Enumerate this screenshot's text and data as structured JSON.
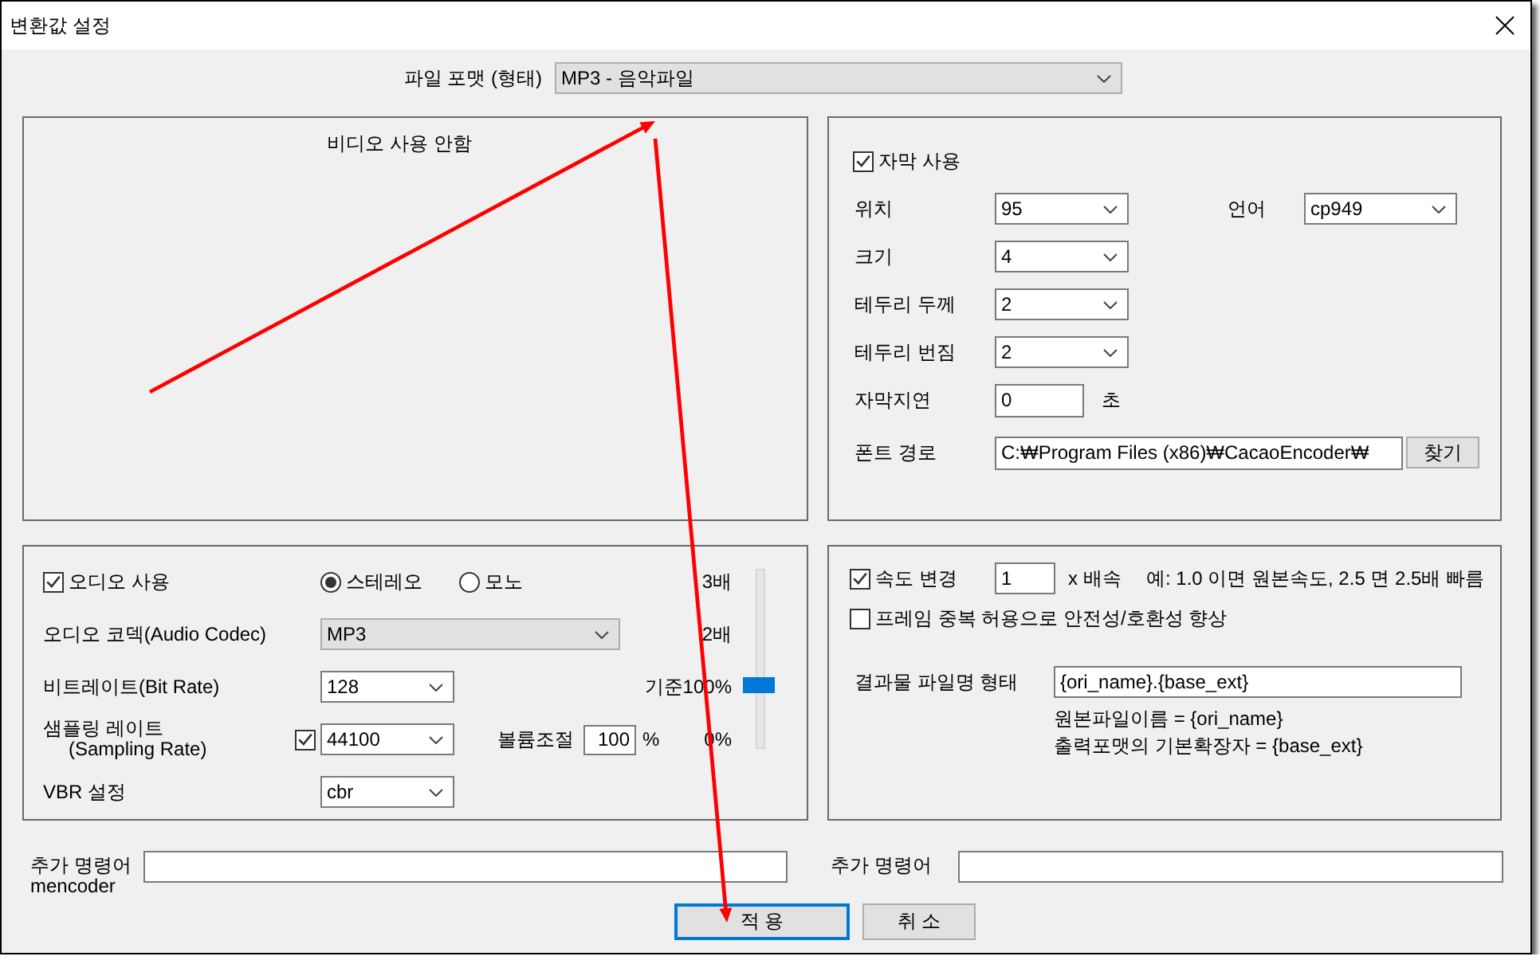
{
  "window": {
    "title": "변환값 설정"
  },
  "file_format": {
    "label": "파일 포맷 (형태)",
    "value": "MP3 - 음악파일"
  },
  "video_panel": {
    "message": "비디오 사용 안함"
  },
  "subtitle_panel": {
    "enable": {
      "label": "자막 사용",
      "checked": true
    },
    "language": {
      "label": "언어",
      "value": "cp949"
    },
    "fields": [
      {
        "kind": "select",
        "label": "위치",
        "value": "95"
      },
      {
        "kind": "select",
        "label": "크기",
        "value": "4"
      },
      {
        "kind": "select",
        "label": "테두리 두께",
        "value": "2"
      },
      {
        "kind": "select",
        "label": "테두리 번짐",
        "value": "2"
      },
      {
        "kind": "input",
        "label": "자막지연",
        "value": "0",
        "unit": "초"
      },
      {
        "kind": "path",
        "label": "폰트 경로",
        "value": "C:₩Program Files (x86)₩CacaoEncoder₩",
        "button": "찾기"
      }
    ]
  },
  "audio_panel": {
    "enable": {
      "label": "오디오 사용",
      "checked": true
    },
    "channels": [
      {
        "label": "스테레오",
        "selected": true
      },
      {
        "label": "모노",
        "selected": false
      }
    ],
    "codec": {
      "label": "오디오 코덱(Audio Codec)",
      "value": "MP3"
    },
    "bitrate": {
      "label": "비트레이트(Bit Rate)",
      "value": "128"
    },
    "sampling": {
      "label": [
        "샘플링 레이트",
        "(Sampling Rate)"
      ],
      "checked": true,
      "value": "44100"
    },
    "volume": {
      "label": "볼륨조절",
      "value": "100",
      "unit": "%"
    },
    "vbr": {
      "label": "VBR 설정",
      "value": "cbr"
    },
    "volume_slider": {
      "ticks": [
        "3배",
        "2배",
        "기준100%",
        "0%"
      ],
      "level": 0.35
    }
  },
  "speed_panel": {
    "speed": {
      "label": "속도 변경",
      "checked": true,
      "value": "1",
      "unit": "x 배속",
      "hint": "예: 1.0 이면 원본속도, 2.5 면 2.5배 빠름"
    },
    "frame_duplication": {
      "label": "프레임 중복 허용으로 안전성/호환성 향상",
      "checked": false
    },
    "output_name": {
      "label": "결과물 파일명 형태",
      "value": "{ori_name}.{base_ext}",
      "notes": [
        "원본파일이름 = {ori_name}",
        "출력포맷의 기본확장자 = {base_ext}"
      ]
    }
  },
  "extra_commands": [
    {
      "label": [
        "추가 명령어",
        "mencoder"
      ]
    },
    {
      "label": [
        "추가 명령어"
      ]
    }
  ],
  "buttons": [
    {
      "label": "적 용",
      "focused": true
    },
    {
      "label": "취 소",
      "focused": false
    }
  ]
}
